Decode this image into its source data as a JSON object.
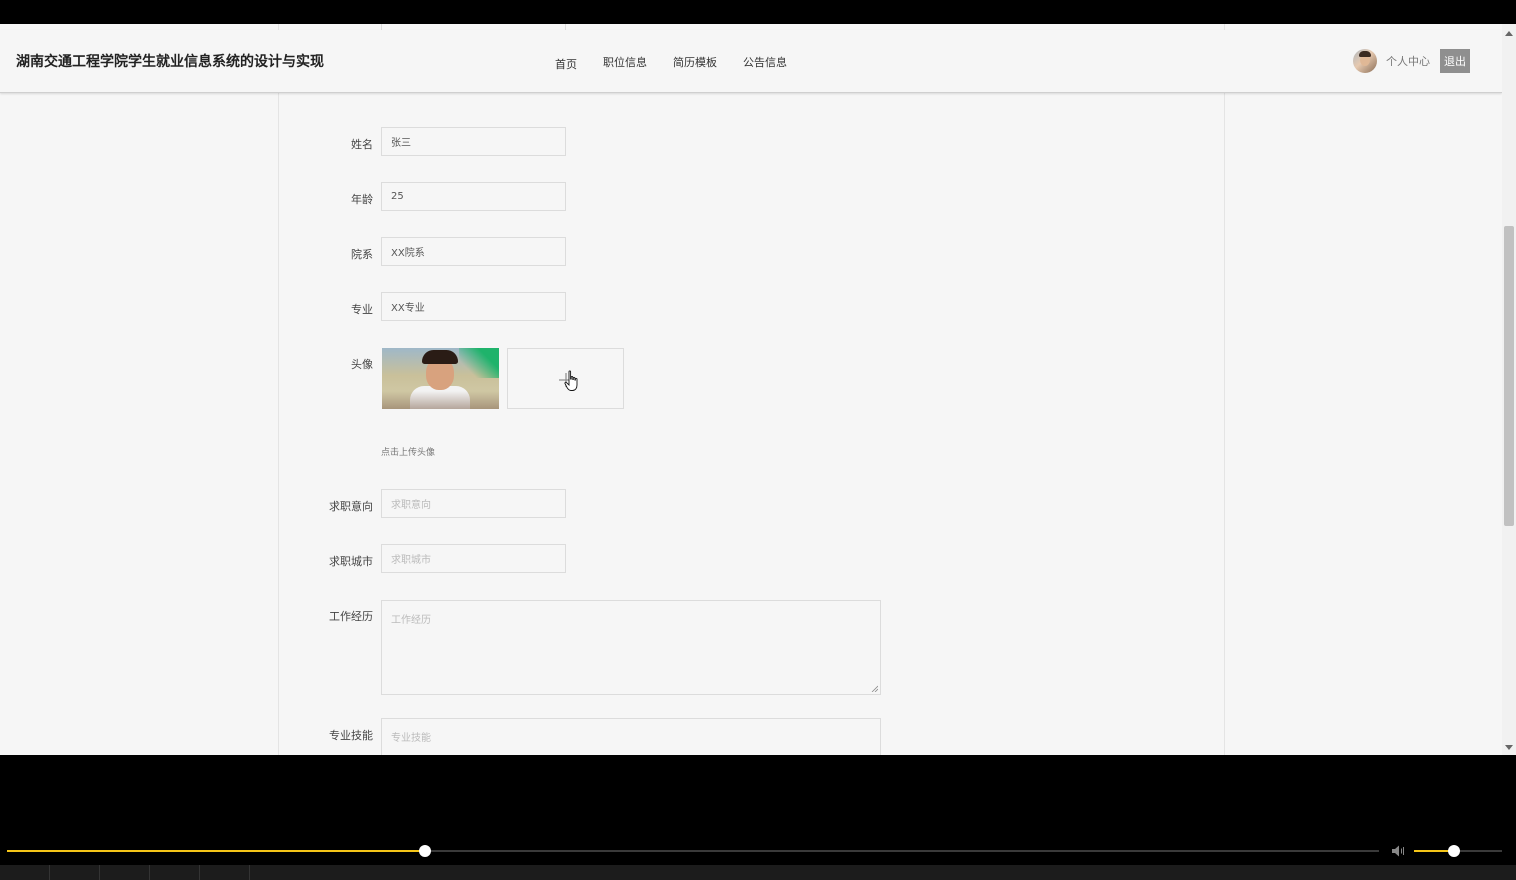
{
  "header": {
    "site_title": "湖南交通工程学院学生就业信息系统的设计与实现",
    "nav": [
      "首页",
      "职位信息",
      "简历模板",
      "公告信息"
    ],
    "user_center": "个人中心",
    "logout": "退出"
  },
  "form": {
    "name": {
      "label": "姓名",
      "value": "张三"
    },
    "age": {
      "label": "年龄",
      "value": "25"
    },
    "department": {
      "label": "院系",
      "value": "XX院系"
    },
    "major": {
      "label": "专业",
      "value": "XX专业"
    },
    "avatar": {
      "label": "头像",
      "hint": "点击上传头像"
    },
    "job_intention": {
      "label": "求职意向",
      "placeholder": "求职意向"
    },
    "job_city": {
      "label": "求职城市",
      "placeholder": "求职城市"
    },
    "work_experience": {
      "label": "工作经历",
      "placeholder": "工作经历"
    },
    "skills": {
      "label": "专业技能",
      "placeholder": "专业技能"
    }
  },
  "player": {
    "progress_percent": 30.5,
    "volume_percent": 45,
    "accent_color": "#f5c518"
  },
  "icons": {
    "plus": "plus-icon",
    "cursor": "hand-pointer-icon",
    "volume": "volume-icon"
  }
}
